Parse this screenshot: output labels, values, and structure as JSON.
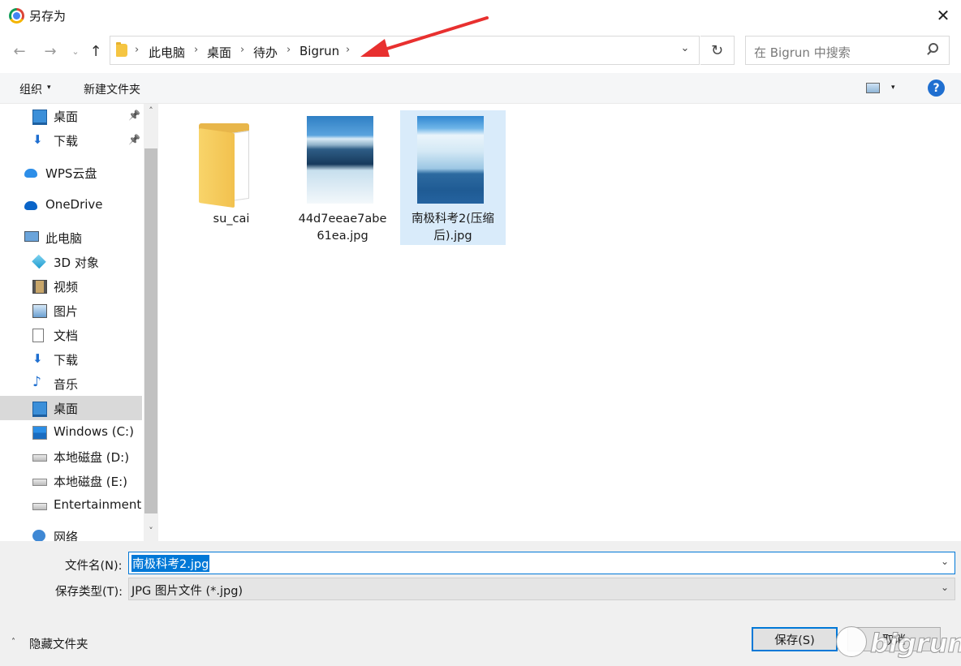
{
  "window": {
    "title": "另存为",
    "close_glyph": "✕"
  },
  "nav": {
    "back_glyph": "←",
    "forward_glyph": "→",
    "recent_glyph": "⌄",
    "up_glyph": "↑",
    "breadcrumb": [
      "此电脑",
      "桌面",
      "待办",
      "Bigrun"
    ],
    "separator": "›",
    "dropdown_glyph": "⌄",
    "refresh_glyph": "↻",
    "search_placeholder": "在 Bigrun 中搜索"
  },
  "toolbar": {
    "organize_label": "组织",
    "caret": "▾",
    "new_folder_label": "新建文件夹",
    "help_glyph": "?"
  },
  "sidebar": {
    "items": [
      {
        "label": "桌面",
        "icon": "desktop-icon",
        "pinned": true
      },
      {
        "label": "下载",
        "icon": "download-icon",
        "pinned": true
      },
      {
        "label": "WPS云盘",
        "icon": "cloud-icon"
      },
      {
        "label": "OneDrive",
        "icon": "onedrive-icon"
      },
      {
        "label": "此电脑",
        "icon": "computer-icon"
      },
      {
        "label": "3D 对象",
        "icon": "cube-icon"
      },
      {
        "label": "视频",
        "icon": "video-icon"
      },
      {
        "label": "图片",
        "icon": "pictures-icon"
      },
      {
        "label": "文档",
        "icon": "document-icon"
      },
      {
        "label": "下载",
        "icon": "download-icon"
      },
      {
        "label": "音乐",
        "icon": "music-icon"
      },
      {
        "label": "桌面",
        "icon": "desktop-icon",
        "selected": true
      },
      {
        "label": "Windows (C:)",
        "icon": "windows-drive-icon"
      },
      {
        "label": "本地磁盘 (D:)",
        "icon": "drive-icon"
      },
      {
        "label": "本地磁盘 (E:)",
        "icon": "drive-icon"
      },
      {
        "label": "Entertainment (",
        "icon": "drive-icon"
      },
      {
        "label": "网络",
        "icon": "network-icon"
      }
    ],
    "pin_glyph": "📌",
    "scroll_up_glyph": "˄",
    "scroll_down_glyph": "˅"
  },
  "files": [
    {
      "name": "su_cai",
      "type": "folder"
    },
    {
      "name": "44d7eeae7abe61ea.jpg",
      "name_line1": "44d7eeae7abe",
      "name_line2": "61ea.jpg",
      "type": "image"
    },
    {
      "name": "南极科考2(压缩后).jpg",
      "name_line1": "南极科考2(压缩",
      "name_line2": "后).jpg",
      "type": "image",
      "selected": true
    }
  ],
  "bottom": {
    "filename_label": "文件名(N):",
    "filename_value": "南极科考2.jpg",
    "filetype_label": "保存类型(T):",
    "filetype_value": "JPG 图片文件 (*.jpg)",
    "dropdown_glyph": "⌄",
    "hide_folders_caret": "˄",
    "hide_folders_label": "隐藏文件夹",
    "save_label": "保存(S)",
    "cancel_label": "取消"
  },
  "colors": {
    "accent": "#0078d7",
    "arrow": "#e8302f",
    "selection": "#d9ebfa",
    "sidebar_selected": "#d9d9d9"
  },
  "watermark": {
    "text": "bigrun"
  }
}
